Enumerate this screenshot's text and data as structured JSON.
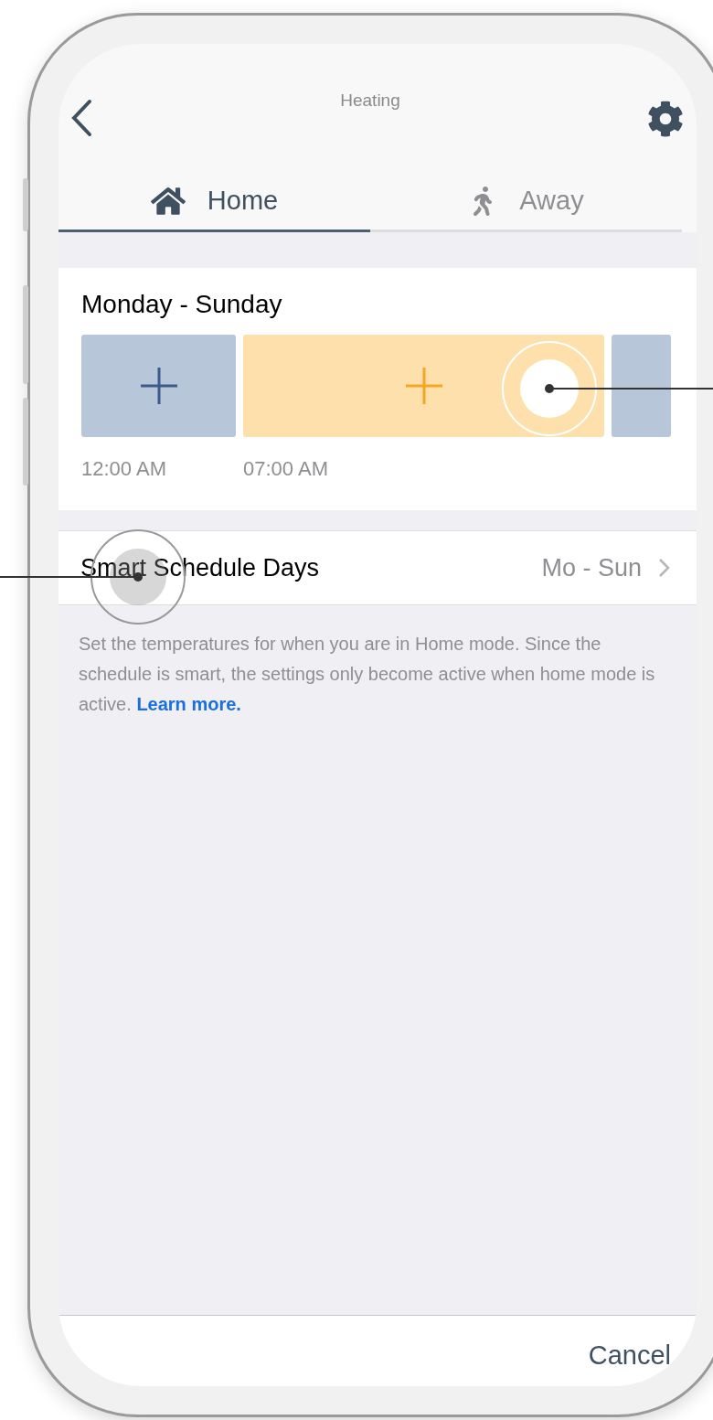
{
  "header": {
    "title": "Heating"
  },
  "tabs": [
    {
      "label": "Home",
      "kind": "home",
      "selected": true
    },
    {
      "label": "Away",
      "kind": "away",
      "selected": false
    }
  ],
  "schedule": {
    "title": "Monday - Sunday",
    "blocks": [
      {
        "color": "#b8c6da",
        "plus": true,
        "time": "12:00 AM"
      },
      {
        "color": "#fde0ab",
        "plus": true,
        "time": "07:00 AM"
      },
      {
        "color": "#b8c6da",
        "plus": false
      }
    ]
  },
  "days_row": {
    "label": "Smart Schedule Days",
    "value": "Mo - Sun"
  },
  "description": {
    "text": "Set the temperatures for when you are in Home mode. Since the schedule is smart, the settings only become active when home mode is active.",
    "link": "Learn more."
  },
  "footer": {
    "button": "Cancel"
  }
}
